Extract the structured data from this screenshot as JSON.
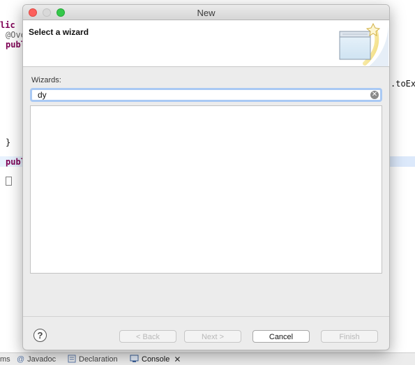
{
  "editor": {
    "lines": [
      "lic",
      "@Ove",
      "publ",
      "}",
      "publ"
    ],
    "right_text": ".toEx"
  },
  "bottom_tabs": [
    {
      "label": "ms"
    },
    {
      "label": "Javadoc",
      "icon": "@"
    },
    {
      "label": "Declaration"
    },
    {
      "label": "Console",
      "close": "✕"
    }
  ],
  "dialog": {
    "title": "New",
    "header_title": "Select a wizard",
    "wizards_label": "Wizards:",
    "search_value": "dy",
    "buttons": {
      "back": "< Back",
      "next": "Next >",
      "cancel": "Cancel",
      "finish": "Finish"
    },
    "help_glyph": "?"
  },
  "colors": {
    "keyword": "#7f0055",
    "focus_ring": "#a9c9f4",
    "close_button": "#fc605c",
    "zoom_button": "#34c84a"
  }
}
